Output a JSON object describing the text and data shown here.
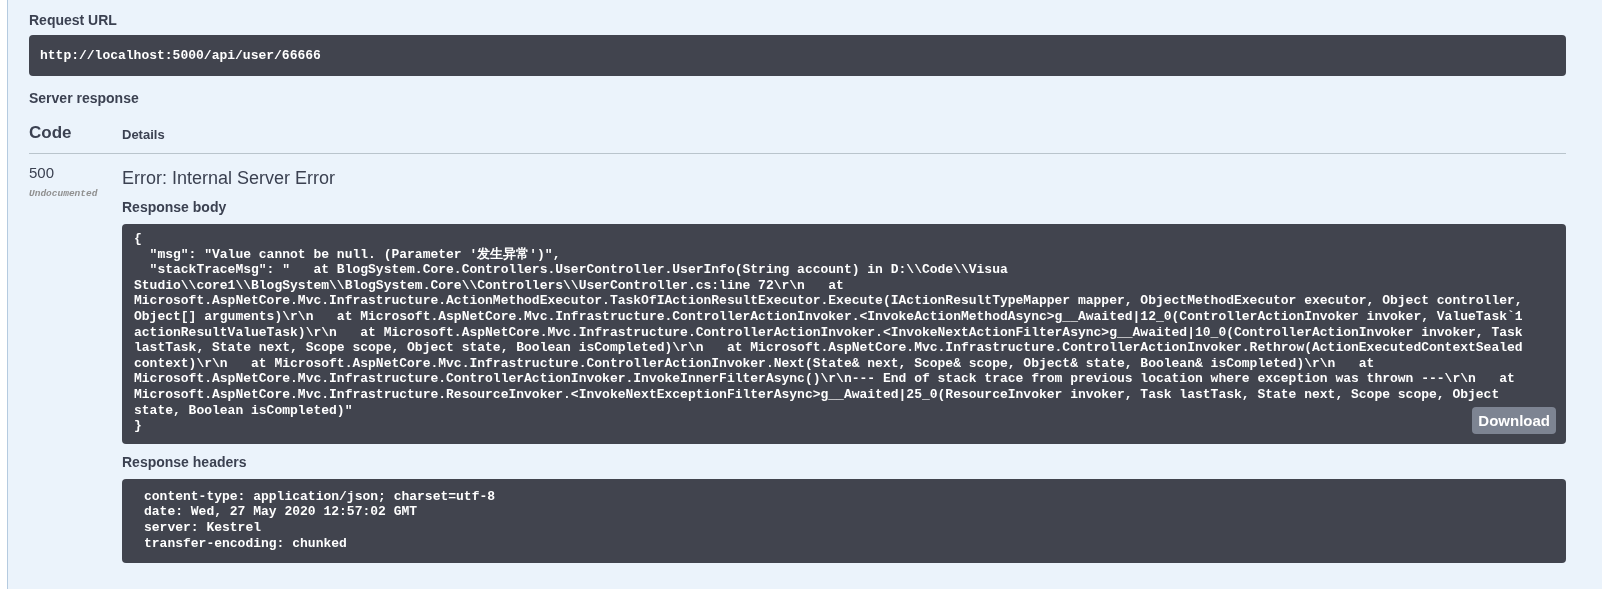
{
  "request_url": {
    "label": "Request URL",
    "url": "http://localhost:5000/api/user/66666"
  },
  "server_response": {
    "label": "Server response",
    "columns": [
      "Code",
      "Details"
    ],
    "rows": [
      {
        "code": "500",
        "note": "Undocumented",
        "title": "Error: Internal Server Error",
        "body_label": "Response body",
        "body_lines": [
          "{",
          "  \"msg\": \"Value cannot be null. (Parameter '发生异常')\",",
          "  \"stackTraceMsg\": \"   at BlogSystem.Core.Controllers.UserController.UserInfo(String account) in D:\\\\Code\\\\Visua",
          "Studio\\\\core1\\\\BlogSystem\\\\BlogSystem.Core\\\\Controllers\\\\UserController.cs:line 72\\r\\n   at",
          "Microsoft.AspNetCore.Mvc.Infrastructure.ActionMethodExecutor.TaskOfIActionResultExecutor.Execute(IActionResultTypeMapper mapper, ObjectMethodExecutor executor, Object controller,",
          "Object[] arguments)\\r\\n   at Microsoft.AspNetCore.Mvc.Infrastructure.ControllerActionInvoker.<InvokeActionMethodAsync>g__Awaited|12_0(ControllerActionInvoker invoker, ValueTask`1",
          "actionResultValueTask)\\r\\n   at Microsoft.AspNetCore.Mvc.Infrastructure.ControllerActionInvoker.<InvokeNextActionFilterAsync>g__Awaited|10_0(ControllerActionInvoker invoker, Task",
          "lastTask, State next, Scope scope, Object state, Boolean isCompleted)\\r\\n   at Microsoft.AspNetCore.Mvc.Infrastructure.ControllerActionInvoker.Rethrow(ActionExecutedContextSealed",
          "context)\\r\\n   at Microsoft.AspNetCore.Mvc.Infrastructure.ControllerActionInvoker.Next(State& next, Scope& scope, Object& state, Boolean& isCompleted)\\r\\n   at",
          "Microsoft.AspNetCore.Mvc.Infrastructure.ControllerActionInvoker.InvokeInnerFilterAsync()\\r\\n--- End of stack trace from previous location where exception was thrown ---\\r\\n   at",
          "Microsoft.AspNetCore.Mvc.Infrastructure.ResourceInvoker.<InvokeNextExceptionFilterAsync>g__Awaited|25_0(ResourceInvoker invoker, Task lastTask, State next, Scope scope, Object",
          "state, Boolean isCompleted)\"",
          "}"
        ],
        "download": "Download",
        "headers_label": "Response headers",
        "header_lines": [
          "content-type: application/json; charset=utf-8",
          "date: Wed, 27 May 2020 12:57:02 GMT",
          "server: Kestrel",
          "transfer-encoding: chunked"
        ]
      }
    ]
  }
}
